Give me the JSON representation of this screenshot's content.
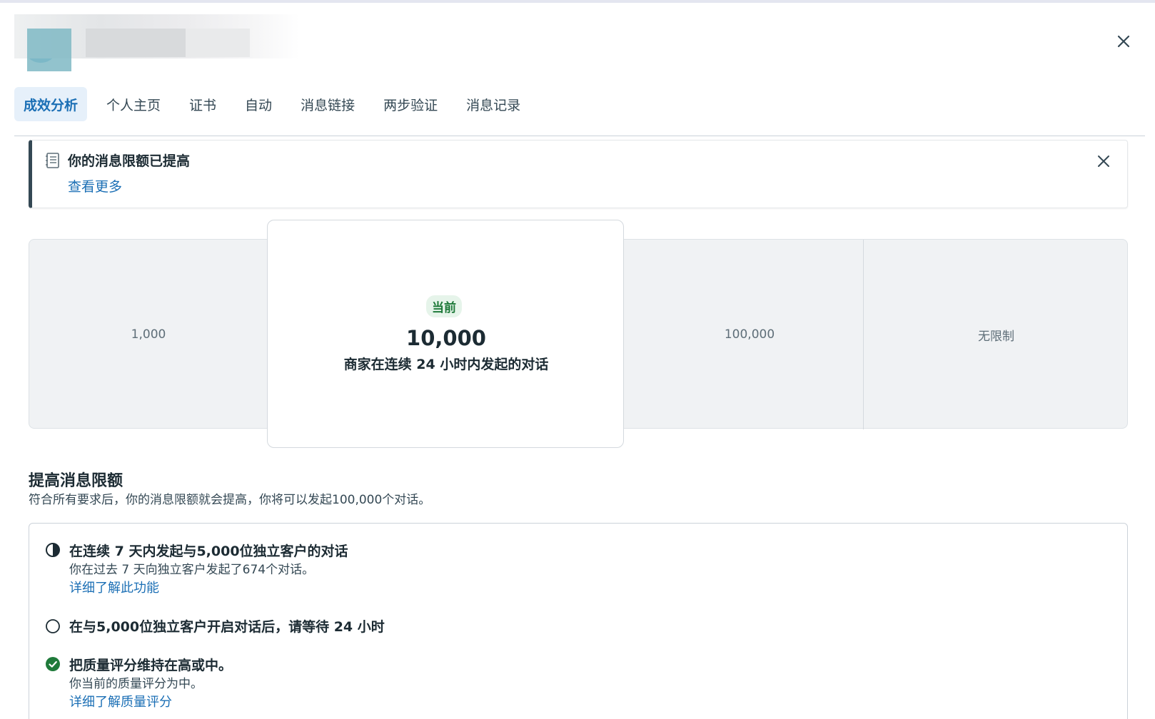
{
  "tabs": [
    {
      "label": "成效分析",
      "active": true
    },
    {
      "label": "个人主页"
    },
    {
      "label": "证书"
    },
    {
      "label": "自动"
    },
    {
      "label": "消息链接"
    },
    {
      "label": "两步验证"
    },
    {
      "label": "消息记录"
    }
  ],
  "banner": {
    "title": "你的消息限额已提高",
    "link": "查看更多"
  },
  "tiers": {
    "tier1": "1,000",
    "current": {
      "badge": "当前",
      "value": "10,000",
      "description": "商家在连续 24 小时内发起的对话"
    },
    "tier3": "100,000",
    "tier4": "无限制"
  },
  "increase": {
    "title": "提高消息限额",
    "subtitle": "符合所有要求后，你的消息限额就会提高，你将可以发起100,000个对话。"
  },
  "requirements": [
    {
      "status": "in-progress",
      "title": "在连续 7 天内发起与5,000位独立客户的对话",
      "description": "你在过去 7 天向独立客户发起了674个对话。",
      "link": "详细了解此功能"
    },
    {
      "status": "pending",
      "title": "在与5,000位独立客户开启对话后，请等待 24 小时"
    },
    {
      "status": "done",
      "title": "把质量评分维持在高或中。",
      "description": "你当前的质量评分为中。",
      "link": "详细了解质量评分"
    }
  ],
  "colors": {
    "accent": "#1b6fb5",
    "success": "#1f7a3a",
    "tab_active_bg": "#e6f0fa"
  }
}
